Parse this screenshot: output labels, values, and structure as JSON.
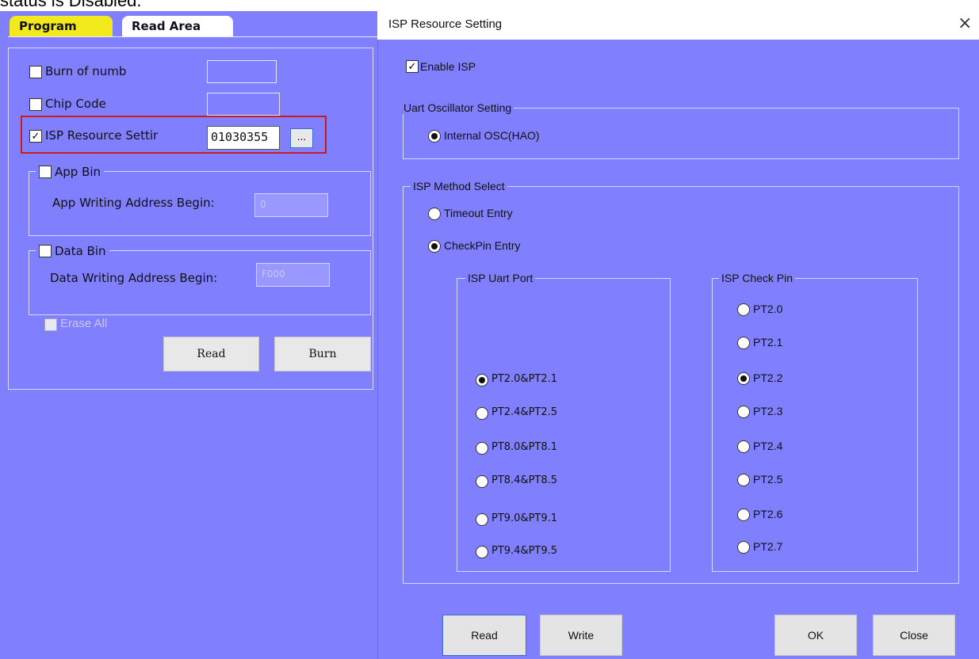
{
  "caption_fragment": "status is Disabled.",
  "tabs": {
    "program": "Program",
    "read_area": "Read Area"
  },
  "left": {
    "burn_of_numb": {
      "label": "Burn of numb",
      "checked": false,
      "value": ""
    },
    "chip_code": {
      "label": "Chip Code",
      "checked": false,
      "value": ""
    },
    "isp_resource": {
      "label": "ISP Resource Settir",
      "checked": true,
      "value": "01030355",
      "browse_label": "..."
    },
    "app_bin": {
      "label": "App Bin",
      "checked": false,
      "address_label": "App Writing Address Begin:",
      "address_value": "0"
    },
    "data_bin": {
      "label": "Data Bin",
      "checked": false,
      "address_label": "Data Writing Address Begin:",
      "address_value": "F000"
    },
    "erase_all": {
      "label": "Erase All",
      "checked": false,
      "enabled": false
    },
    "read_button": "Read",
    "burn_button": "Burn"
  },
  "dialog": {
    "title": "ISP Resource Setting",
    "close_glyph": "×",
    "enable_isp": {
      "label": "Enable ISP",
      "checked": true
    },
    "uart_osc": {
      "legend": "Uart Oscillator Setting",
      "option": "Internal OSC(HAO)",
      "selected": true
    },
    "method": {
      "legend": "ISP Method Select",
      "options": [
        {
          "label": "Timeout Entry",
          "selected": false
        },
        {
          "label": "CheckPin Entry",
          "selected": true
        }
      ]
    },
    "uart_port": {
      "legend": "ISP Uart Port",
      "options": [
        {
          "label": "PT2.0&PT2.1",
          "selected": true
        },
        {
          "label": "PT2.4&PT2.5",
          "selected": false
        },
        {
          "label": "PT8.0&PT8.1",
          "selected": false
        },
        {
          "label": "PT8.4&PT8.5",
          "selected": false
        },
        {
          "label": "PT9.0&PT9.1",
          "selected": false
        },
        {
          "label": "PT9.4&PT9.5",
          "selected": false
        }
      ]
    },
    "check_pin": {
      "legend": "ISP Check Pin",
      "options": [
        {
          "label": "PT2.0",
          "selected": false
        },
        {
          "label": "PT2.1",
          "selected": false
        },
        {
          "label": "PT2.2",
          "selected": true
        },
        {
          "label": "PT2.3",
          "selected": false
        },
        {
          "label": "PT2.4",
          "selected": false
        },
        {
          "label": "PT2.5",
          "selected": false
        },
        {
          "label": "PT2.6",
          "selected": false
        },
        {
          "label": "PT2.7",
          "selected": false
        }
      ]
    },
    "buttons": {
      "read": "Read",
      "write": "Write",
      "ok": "OK",
      "close": "Close"
    }
  },
  "colors": {
    "panel_bg": "#8080ff",
    "program_tab": "#f2ea1c",
    "highlight_box": "#cc1a1a"
  }
}
